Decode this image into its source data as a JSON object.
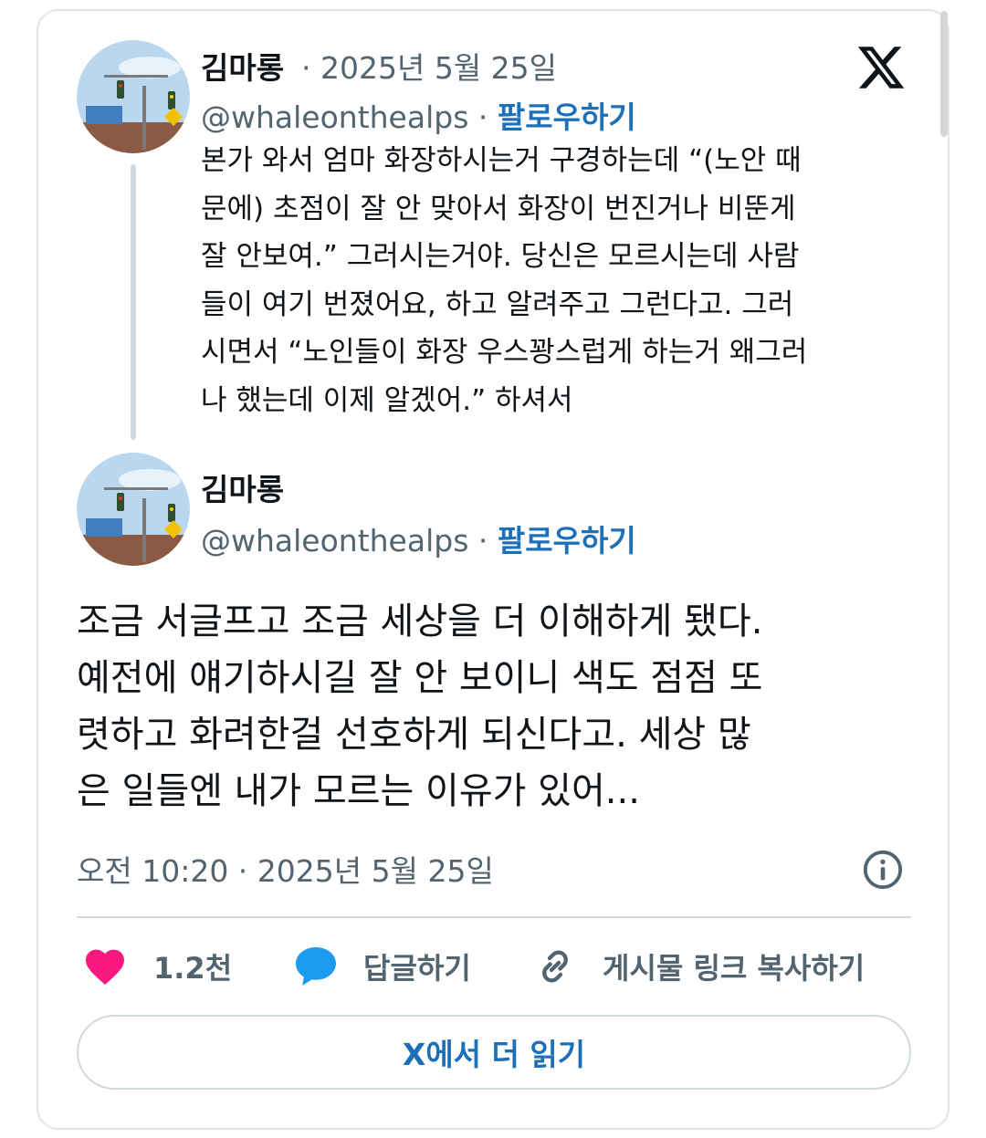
{
  "quoted_tweet": {
    "display_name": "김마롱",
    "date": "2025년 5월 25일",
    "separator": "·",
    "handle": "@whaleonthealps",
    "follow_label": "팔로우하기",
    "text_lines": [
      "본가 와서 엄마 화장하시는거 구경하는데 “(노안 때",
      "문에) 초점이 잘 안 맞아서 화장이 번진거나 비뚠게",
      "잘 안보여.” 그러시는거야. 당신은 모르시는데 사람",
      "들이 여기 번졌어요, 하고 알려주고 그런다고. 그러",
      "시면서 “노인들이 화장 우스꽝스럽게 하는거 왜그러",
      "나 했는데 이제 알겠어.” 하셔서"
    ]
  },
  "main_tweet": {
    "display_name": "김마롱",
    "handle": "@whaleonthealps",
    "separator": "·",
    "follow_label": "팔로우하기",
    "text_lines": [
      "조금 서글프고 조금 세상을 더 이해하게 됐다.",
      "예전에 얘기하시길 잘 안 보이니 색도 점점 또",
      "렷하고 화려한걸 선호하게 되신다고. 세상 많",
      "은 일들엔 내가 모르는 이유가 있어..."
    ],
    "timestamp": "오전 10:20 · 2025년 5월 25일"
  },
  "actions": {
    "like_count": "1.2천",
    "reply_label": "답글하기",
    "copy_link_label": "게시물 링크 복사하기"
  },
  "read_more_label": "X에서 더 읽기",
  "colors": {
    "accent": "#1d70b8",
    "like": "#f91880",
    "reply": "#1d9bf0",
    "muted": "#536471",
    "text": "#0f1419"
  },
  "icons": [
    "x-logo-icon",
    "info-icon",
    "heart-icon",
    "speech-bubble-icon",
    "link-icon"
  ]
}
